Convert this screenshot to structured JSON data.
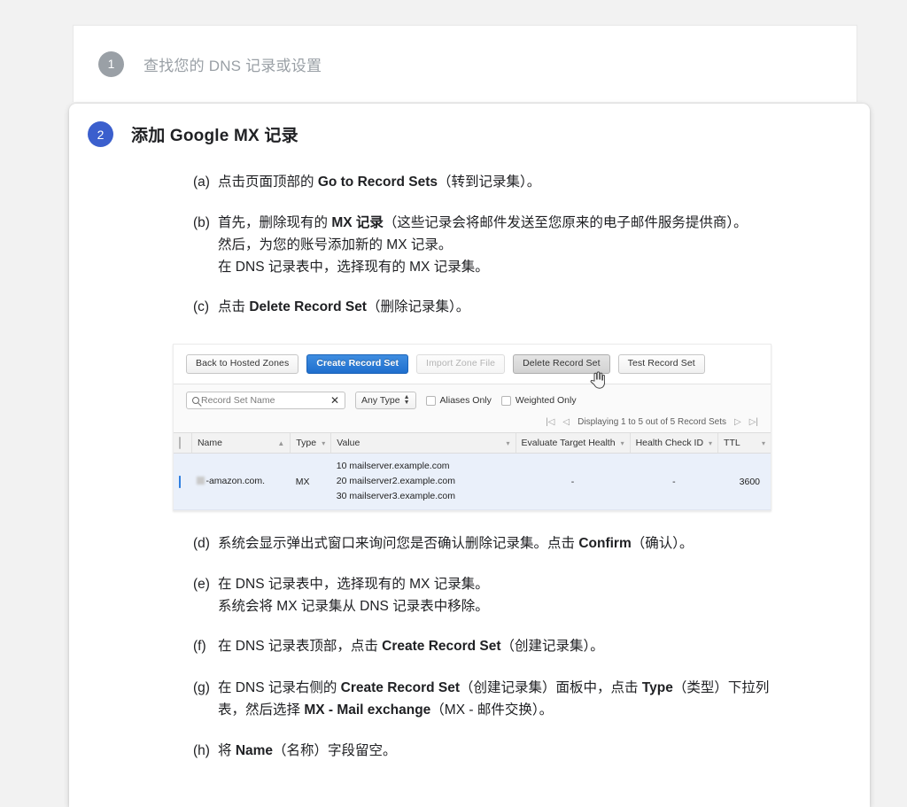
{
  "steps_nav": {
    "step1": {
      "number": "1",
      "title": "查找您的 DNS 记录或设置"
    },
    "step2": {
      "number": "2",
      "title": "添加 Google MX 记录"
    }
  },
  "instructions": [
    {
      "marker": "(a)",
      "lines": [
        [
          {
            "t": "点击页面顶部的 ",
            "b": false
          },
          {
            "t": "Go to Record Sets",
            "b": true
          },
          {
            "t": "（转到记录集）。",
            "b": false
          }
        ]
      ]
    },
    {
      "marker": "(b)",
      "lines": [
        [
          {
            "t": "首先，删除现有的 ",
            "b": false
          },
          {
            "t": "MX 记录",
            "b": true
          },
          {
            "t": "（这些记录会将邮件发送至您原来的电子邮件服务提供商）。",
            "b": false
          }
        ],
        [
          {
            "t": "然后，为您的账号添加新的 MX 记录。",
            "b": false
          }
        ],
        [
          {
            "t": "在 DNS 记录表中，选择现有的 MX 记录集。",
            "b": false
          }
        ]
      ]
    },
    {
      "marker": "(c)",
      "lines": [
        [
          {
            "t": "点击 ",
            "b": false
          },
          {
            "t": "Delete Record Set",
            "b": true
          },
          {
            "t": "（删除记录集）。",
            "b": false
          }
        ]
      ]
    }
  ],
  "instructions_after": [
    {
      "marker": "(d)",
      "lines": [
        [
          {
            "t": "系统会显示弹出式窗口来询问您是否确认删除记录集。点击 ",
            "b": false
          },
          {
            "t": "Confirm",
            "b": true
          },
          {
            "t": "（确认）。",
            "b": false
          }
        ]
      ]
    },
    {
      "marker": "(e)",
      "lines": [
        [
          {
            "t": "在 DNS 记录表中，选择现有的 MX 记录集。",
            "b": false
          }
        ],
        [
          {
            "t": "系统会将 MX 记录集从 DNS 记录表中移除。",
            "b": false
          }
        ]
      ]
    },
    {
      "marker": "(f)",
      "lines": [
        [
          {
            "t": "在 DNS 记录表顶部，点击 ",
            "b": false
          },
          {
            "t": "Create Record Set",
            "b": true
          },
          {
            "t": "（创建记录集）。",
            "b": false
          }
        ]
      ]
    },
    {
      "marker": "(g)",
      "lines": [
        [
          {
            "t": "在 DNS 记录右侧的 ",
            "b": false
          },
          {
            "t": "Create Record Set",
            "b": true
          },
          {
            "t": "（创建记录集）面板中，点击 ",
            "b": false
          },
          {
            "t": "Type",
            "b": true
          },
          {
            "t": "（类型）下拉列",
            "b": false
          }
        ],
        [
          {
            "t": "表，然后选择 ",
            "b": false
          },
          {
            "t": "MX - Mail exchange",
            "b": true
          },
          {
            "t": "（MX - 邮件交换）。",
            "b": false
          }
        ]
      ]
    },
    {
      "marker": "(h)",
      "lines": [
        [
          {
            "t": "将 ",
            "b": false
          },
          {
            "t": "Name",
            "b": true
          },
          {
            "t": "（名称）字段留空。",
            "b": false
          }
        ]
      ]
    }
  ],
  "screenshot": {
    "toolbar_buttons": [
      {
        "label": "Back to Hosted Zones",
        "style": "default"
      },
      {
        "label": "Create Record Set",
        "style": "primary"
      },
      {
        "label": "Import Zone File",
        "style": "disabled"
      },
      {
        "label": "Delete Record Set",
        "style": "hovered"
      },
      {
        "label": "Test Record Set",
        "style": "default"
      }
    ],
    "cursor_icon": "pointing-hand-cursor",
    "filters": {
      "search_placeholder": "Record Set Name",
      "search_value": "",
      "search_icon": "search-icon",
      "clear_icon": "✕",
      "type_filter": "Any Type",
      "checkbox_aliases": "Aliases Only",
      "checkbox_weighted": "Weighted Only"
    },
    "pager": {
      "first_icon": "|◁",
      "prev_icon": "◁",
      "text": "Displaying 1 to 5 out of 5 Record Sets",
      "next_icon": "▷",
      "last_icon": "▷|"
    },
    "table": {
      "columns": [
        {
          "label": "",
          "kind": "checkbox"
        },
        {
          "label": "Name",
          "sort": "▲"
        },
        {
          "label": "Type",
          "sort": "▾"
        },
        {
          "label": "Value",
          "sort": "▾"
        },
        {
          "label": "Evaluate Target Health",
          "sort": "▾"
        },
        {
          "label": "Health Check ID",
          "sort": "▾"
        },
        {
          "label": "TTL",
          "sort": "▾"
        }
      ],
      "rows": [
        {
          "selected": true,
          "name": "-amazon.com.",
          "name_blurred_prefix": true,
          "type": "MX",
          "values": [
            "10 mailserver.example.com",
            "20 mailserver2.example.com",
            "30 mailserver3.example.com"
          ],
          "evaluate_target_health": "-",
          "health_check_id": "-",
          "ttl": "3600"
        }
      ]
    }
  },
  "colors": {
    "page_background": "#f2f2f2",
    "card_background": "#ffffff",
    "badge_inactive": "#9aa0a6",
    "badge_active": "#3b5fcd",
    "primary_button": "#1f6fce",
    "selected_row": "#eaf0fa",
    "text_primary": "#202124",
    "text_muted": "#9aa0a6"
  }
}
